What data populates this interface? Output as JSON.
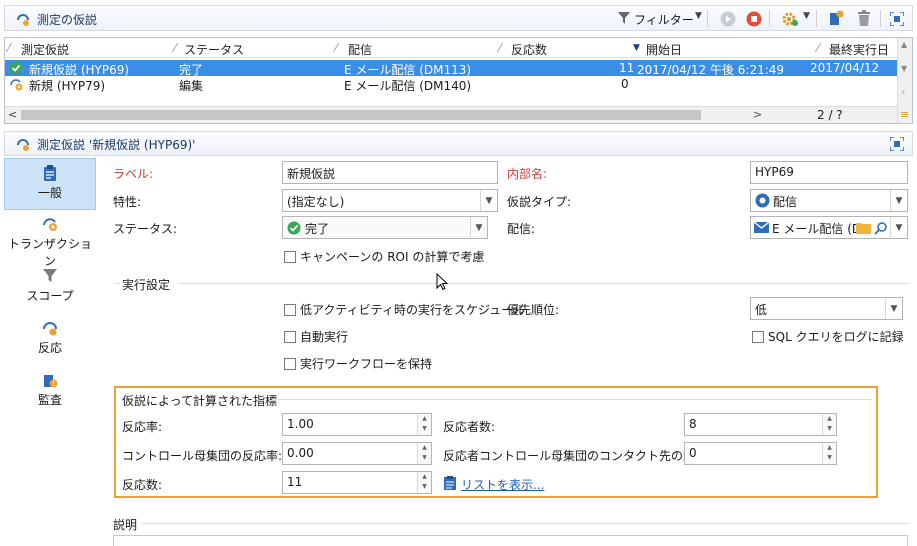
{
  "top_bar": {
    "title": "測定の仮説",
    "filter_label": "フィルター",
    "colors": {
      "accent": "#3a8ee6",
      "stop": "#e84a3a",
      "orange": "#f0a030"
    }
  },
  "grid": {
    "columns": [
      "測定仮説",
      "ステータス",
      "配信",
      "反応数",
      "開始日",
      "最終実行日"
    ],
    "rows": [
      {
        "name": "新規仮説 (HYP69)",
        "status": "完了",
        "delivery": "E メール配信 (DM113)",
        "responses": "11",
        "start": "2017/04/12 午後 6:21:49",
        "last": "2017/04/12",
        "selected": true
      },
      {
        "name": "新規 (HYP79)",
        "status": "編集",
        "delivery": "E メール配信 (DM140)",
        "responses": "0",
        "start": "",
        "last": "",
        "selected": false
      }
    ],
    "page_indicator": "2 / ?"
  },
  "detail": {
    "title": "測定仮説 '新規仮説 (HYP69)'",
    "nav": [
      {
        "label": "一般",
        "icon": "clipboard-icon"
      },
      {
        "label": "トランザクション",
        "icon": "transaction-icon"
      },
      {
        "label": "スコープ",
        "icon": "filter-icon"
      },
      {
        "label": "反応",
        "icon": "reaction-icon"
      },
      {
        "label": "監査",
        "icon": "audit-icon"
      }
    ],
    "form": {
      "label_label": "ラベル:",
      "label_value": "新規仮説",
      "internal_name_label": "内部名:",
      "internal_name_value": "HYP69",
      "nature_label": "特性:",
      "nature_value": "(指定なし)",
      "hypothesis_type_label": "仮説タイプ:",
      "hypothesis_type_value": "配信",
      "status_label": "ステータス:",
      "status_value": "完了",
      "delivery_label": "配信:",
      "delivery_value": "E メール配信 (D",
      "roi_checkbox": "キャンペーンの ROI の計算で考慮"
    },
    "execution": {
      "section_title": "実行設定",
      "schedule_low_activity": "低アクティビティ時の実行をスケジュール",
      "auto_execute": "自動実行",
      "keep_workflow": "実行ワークフローを保持",
      "priority_label": "優先順位:",
      "priority_value": "低",
      "sql_log": "SQL クエリをログに記録"
    },
    "metrics": {
      "section_title": "仮説によって計算された指標",
      "response_rate_label": "反応率:",
      "response_rate_value": "1.00",
      "responders_label": "反応者数:",
      "responders_value": "8",
      "control_rate_label": "コントロール母集団の反応率:",
      "control_rate_value": "0.00",
      "control_contacts_label": "反応者コントロール母集団のコンタクト先の数:",
      "control_contacts_value": "0",
      "responses_label": "反応数:",
      "responses_value": "11",
      "show_list_link": "リストを表示..."
    },
    "description": {
      "section_title": "説明"
    }
  }
}
